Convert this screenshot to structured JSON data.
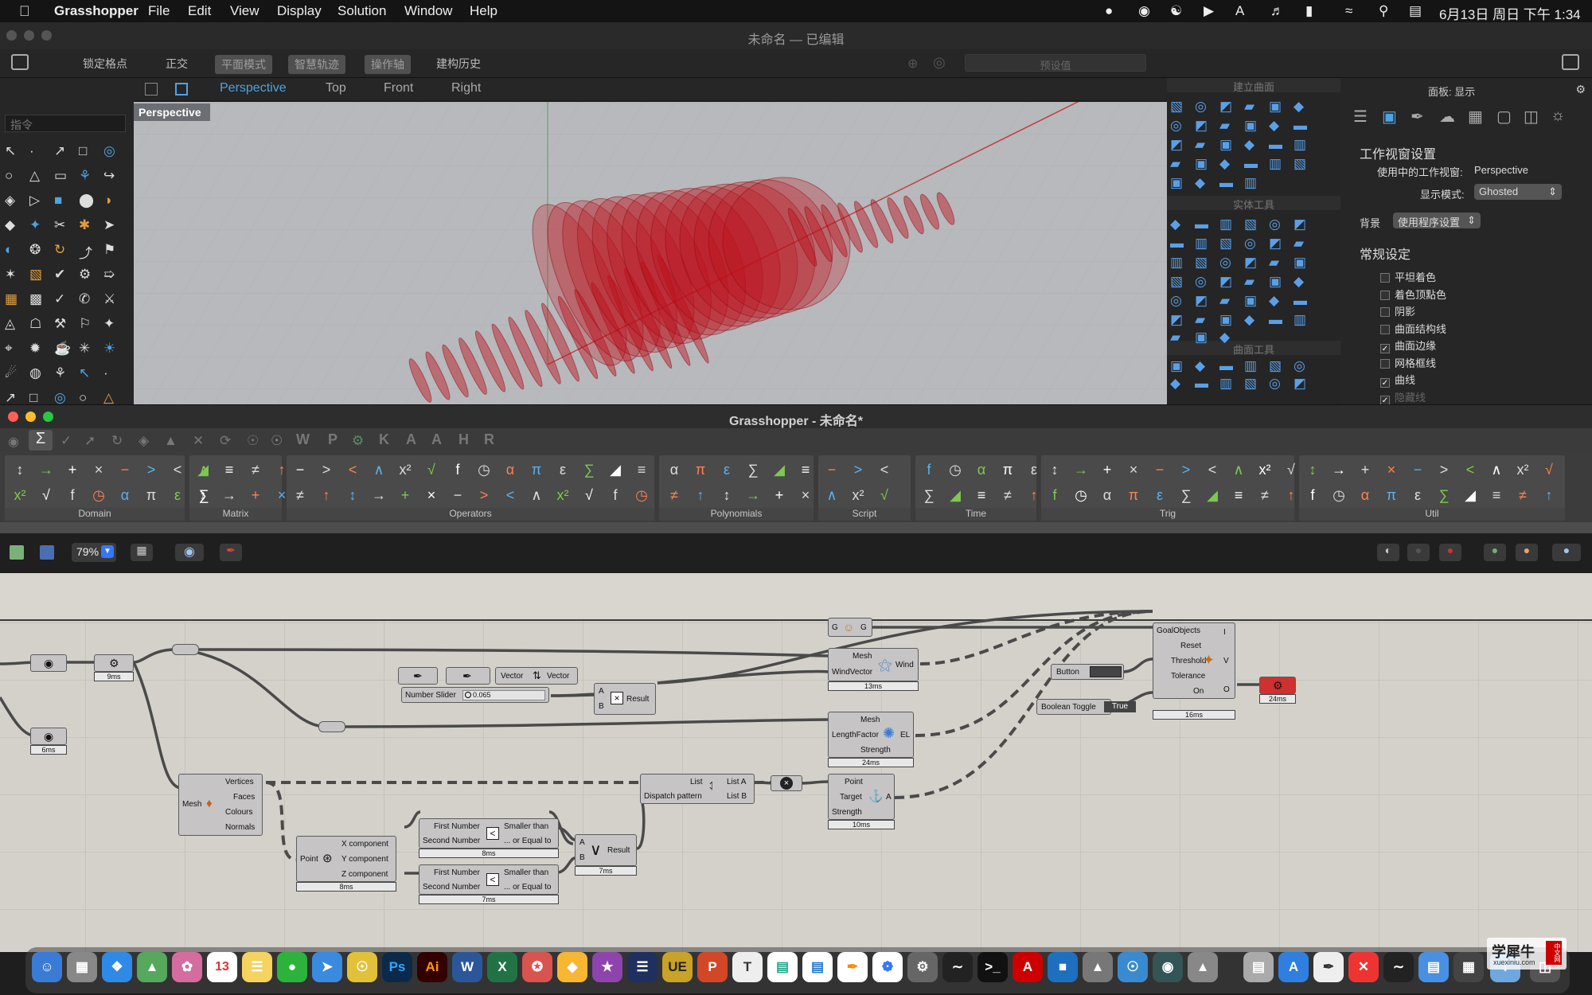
{
  "menubar": {
    "app": "Grasshopper",
    "items": [
      "File",
      "Edit",
      "View",
      "Display",
      "Solution",
      "Window",
      "Help"
    ],
    "datetime": "6月13日 周日 下午 1:34"
  },
  "window": {
    "title": "未命名 — 已编辑"
  },
  "rhino_toolbar": {
    "modes": [
      "锁定格点",
      "正交",
      "平面模式",
      "智慧轨迹",
      "操作轴",
      "建构历史"
    ],
    "preset_placeholder": "预设值"
  },
  "command": {
    "placeholder": "指令"
  },
  "viewport_tabs": [
    "Perspective",
    "Top",
    "Front",
    "Right"
  ],
  "viewport_label": "Perspective",
  "right_tool_groups": [
    "建立曲面",
    "实体工具",
    "曲面工具"
  ],
  "properties": {
    "header": "面板: 显示",
    "section_title": "工作视窗设置",
    "active_viewport_label": "使用中的工作视窗:",
    "active_viewport_value": "Perspective",
    "display_mode_label": "显示模式:",
    "display_mode_value": "Ghosted",
    "background_label": "背景",
    "background_value": "使用程序设置",
    "general_title": "常规设定",
    "checkboxes": [
      {
        "label": "平坦着色",
        "checked": false
      },
      {
        "label": "着色顶點色",
        "checked": false
      },
      {
        "label": "阴影",
        "checked": false
      },
      {
        "label": "曲面结构线",
        "checked": false
      },
      {
        "label": "曲面边缘",
        "checked": true
      },
      {
        "label": "网格框线",
        "checked": false
      },
      {
        "label": "曲线",
        "checked": true
      },
      {
        "label": "隐藏线",
        "checked": true
      }
    ]
  },
  "gh": {
    "title": "Grasshopper - 未命名*",
    "tab_letters": [
      "W",
      "P",
      "K",
      "A",
      "A",
      "H",
      "R"
    ],
    "ribbon_sections": [
      "Domain",
      "Matrix",
      "Operators",
      "Polynomials",
      "Script",
      "Time",
      "Trig",
      "Util"
    ],
    "zoom": "79%",
    "canvas": {
      "timers": {
        "t1": "9ms",
        "t2": "6ms",
        "wind": "13ms",
        "el": "24ms",
        "anchor": "10ms",
        "solver": "16ms",
        "out": "24ms",
        "and": "7ms",
        "dec": "8ms",
        "cmp1": "8ms",
        "cmp2": "7ms"
      },
      "slider": {
        "label": "Number Slider",
        "value": "0.065"
      },
      "vector": {
        "in": "Vector",
        "out": "Vector"
      },
      "multiply": {
        "a": "A",
        "b": "B",
        "out": "Result"
      },
      "wind": {
        "in1": "Mesh",
        "in2": "WindVector",
        "out": "Wind"
      },
      "length": {
        "in1": "Mesh",
        "in2": "LengthFactor",
        "in3": "Strength",
        "out": "EL"
      },
      "solver": {
        "in": [
          "GoalObjects",
          "Reset",
          "Threshold",
          "Tolerance",
          "On"
        ],
        "out": [
          "I",
          "V",
          "O"
        ]
      },
      "button": {
        "label": "Button"
      },
      "toggle": {
        "label": "Boolean Toggle",
        "value": "True"
      },
      "gg": {
        "in": "G",
        "out": "G"
      },
      "deconstruct_mesh": {
        "in": "Mesh",
        "out": [
          "Vertices",
          "Faces",
          "Colours",
          "Normals"
        ]
      },
      "dispatch": {
        "in": [
          "List",
          "Dispatch pattern"
        ],
        "out": [
          "List A",
          "List B"
        ]
      },
      "anchor": {
        "in": [
          "Point",
          "Target",
          "Strength"
        ],
        "out": "A"
      },
      "deconstruct_point": {
        "in": "Point",
        "out": [
          "X component",
          "Y component",
          "Z component"
        ]
      },
      "compare": {
        "in": [
          "First Number",
          "Second Number"
        ],
        "out": [
          "Smaller than",
          "... or Equal to"
        ]
      },
      "and_gate": {
        "a": "A",
        "b": "B",
        "out": "Result"
      }
    }
  },
  "watermark": {
    "text": "学犀牛",
    "site": "xuexiniu.com",
    "stamp": "中文网"
  },
  "colors": {
    "accent": "#4fa3e0",
    "geometry": "#c0101a",
    "canvas": "#d4d1ca"
  }
}
